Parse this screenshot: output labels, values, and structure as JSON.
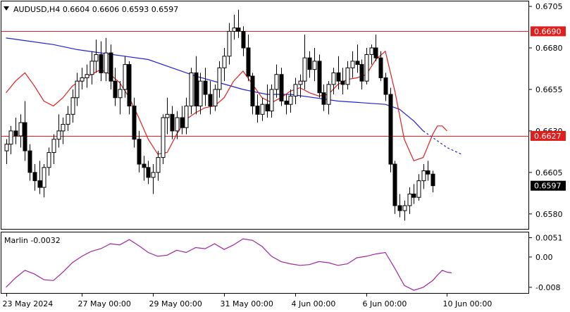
{
  "window": {
    "symbol_header": "AUDUSD,H4  0.6604 0.6606 0.6593 0.6597",
    "menu_icon": "triangle-down-icon"
  },
  "colors": {
    "background": "#ffffff",
    "frame": "#000000",
    "candle_border": "#000000",
    "bull_fill": "#ffffff",
    "bear_fill": "#000000",
    "ma_slow": "#1f23d6",
    "ma_fast": "#e01e1e",
    "hline": "#e01e1e",
    "level_label_bg": "#e01e1e",
    "current_label_bg": "#000000",
    "oscillator": "#a0269f"
  },
  "chart_data": [
    {
      "type": "candlestick",
      "title": "AUDUSD,H4  0.6604 0.6606 0.6593 0.6597",
      "timeframe": "H4",
      "ohlc_readout": {
        "open": 0.6604,
        "high": 0.6606,
        "low": 0.6593,
        "close": 0.6597
      },
      "ylim": [
        0.6571,
        0.6708
      ],
      "y_ticks": [
        "0.6705",
        "0.6680",
        "0.6655",
        "0.6630",
        "0.6605",
        "0.6580"
      ],
      "x_ticks": [
        "23 May 2024",
        "27 May 00:00",
        "29 May 00:00",
        "31 May 00:00",
        "4 Jun 00:00",
        "6 Jun 00:00",
        "10 Jun 00:00"
      ],
      "x_tick_index": [
        0,
        16,
        31,
        46,
        61,
        76,
        93
      ],
      "grid": false,
      "horizontal_levels": [
        {
          "value": 0.669,
          "label": "0.6690"
        },
        {
          "value": 0.6627,
          "label": "0.6627"
        }
      ],
      "current_price": {
        "value": 0.6597,
        "label": "0.6597"
      },
      "candles": [
        [
          0.6618,
          0.6625,
          0.661,
          0.6622
        ],
        [
          0.6622,
          0.6633,
          0.6616,
          0.663
        ],
        [
          0.663,
          0.6638,
          0.6622,
          0.6627
        ],
        [
          0.6627,
          0.664,
          0.662,
          0.6635
        ],
        [
          0.6635,
          0.6648,
          0.6612,
          0.6618
        ],
        [
          0.6618,
          0.6622,
          0.66,
          0.6605
        ],
        [
          0.6605,
          0.661,
          0.6594,
          0.66
        ],
        [
          0.66,
          0.6612,
          0.6592,
          0.6596
        ],
        [
          0.6596,
          0.661,
          0.659,
          0.6608
        ],
        [
          0.6608,
          0.662,
          0.6603,
          0.6617
        ],
        [
          0.6617,
          0.6628,
          0.661,
          0.6625
        ],
        [
          0.6625,
          0.664,
          0.662,
          0.663
        ],
        [
          0.663,
          0.6638,
          0.6622,
          0.6634
        ],
        [
          0.6634,
          0.6645,
          0.663,
          0.664
        ],
        [
          0.664,
          0.6655,
          0.6635,
          0.665
        ],
        [
          0.665,
          0.6665,
          0.6645,
          0.666
        ],
        [
          0.666,
          0.6668,
          0.6655,
          0.6662
        ],
        [
          0.6662,
          0.667,
          0.6656,
          0.6664
        ],
        [
          0.6664,
          0.6678,
          0.6658,
          0.6672
        ],
        [
          0.6672,
          0.6685,
          0.6665,
          0.6676
        ],
        [
          0.6676,
          0.6684,
          0.666,
          0.6665
        ],
        [
          0.6665,
          0.6686,
          0.666,
          0.6677
        ],
        [
          0.6677,
          0.6682,
          0.6655,
          0.666
        ],
        [
          0.666,
          0.6668,
          0.6645,
          0.665
        ],
        [
          0.665,
          0.666,
          0.664,
          0.6655
        ],
        [
          0.6655,
          0.6675,
          0.665,
          0.667
        ],
        [
          0.667,
          0.6672,
          0.664,
          0.6645
        ],
        [
          0.6645,
          0.665,
          0.662,
          0.6625
        ],
        [
          0.6625,
          0.663,
          0.6605,
          0.661
        ],
        [
          0.661,
          0.6615,
          0.66,
          0.6608
        ],
        [
          0.6608,
          0.6612,
          0.6598,
          0.6602
        ],
        [
          0.6602,
          0.661,
          0.6592,
          0.6605
        ],
        [
          0.6605,
          0.6618,
          0.66,
          0.6614
        ],
        [
          0.6614,
          0.664,
          0.661,
          0.6638
        ],
        [
          0.6638,
          0.665,
          0.6628,
          0.664
        ],
        [
          0.664,
          0.6645,
          0.6625,
          0.663
        ],
        [
          0.663,
          0.6642,
          0.6625,
          0.6638
        ],
        [
          0.6638,
          0.6645,
          0.6628,
          0.6632
        ],
        [
          0.6632,
          0.665,
          0.6628,
          0.6645
        ],
        [
          0.6645,
          0.6668,
          0.664,
          0.6665
        ],
        [
          0.6665,
          0.6675,
          0.664,
          0.6645
        ],
        [
          0.6645,
          0.6665,
          0.664,
          0.666
        ],
        [
          0.666,
          0.6668,
          0.6645,
          0.6652
        ],
        [
          0.6652,
          0.666,
          0.664,
          0.6645
        ],
        [
          0.6645,
          0.6658,
          0.6642,
          0.6655
        ],
        [
          0.6655,
          0.6672,
          0.665,
          0.6668
        ],
        [
          0.6668,
          0.668,
          0.666,
          0.6675
        ],
        [
          0.6675,
          0.6695,
          0.667,
          0.669
        ],
        [
          0.669,
          0.67,
          0.6685,
          0.6692
        ],
        [
          0.6692,
          0.6703,
          0.6686,
          0.669
        ],
        [
          0.669,
          0.6693,
          0.6675,
          0.668
        ],
        [
          0.668,
          0.6688,
          0.666,
          0.6663
        ],
        [
          0.6663,
          0.6665,
          0.664,
          0.6645
        ],
        [
          0.6645,
          0.6652,
          0.6635,
          0.664
        ],
        [
          0.664,
          0.665,
          0.6636,
          0.6646
        ],
        [
          0.6646,
          0.6658,
          0.6638,
          0.6642
        ],
        [
          0.6642,
          0.6658,
          0.6638,
          0.6655
        ],
        [
          0.6655,
          0.667,
          0.665,
          0.6664
        ],
        [
          0.6664,
          0.6668,
          0.6645,
          0.6648
        ],
        [
          0.6648,
          0.6652,
          0.664,
          0.6646
        ],
        [
          0.6646,
          0.6655,
          0.6641,
          0.6651
        ],
        [
          0.6651,
          0.6662,
          0.6646,
          0.6658
        ],
        [
          0.6658,
          0.6664,
          0.665,
          0.666
        ],
        [
          0.666,
          0.6688,
          0.6655,
          0.6674
        ],
        [
          0.6674,
          0.6678,
          0.6662,
          0.6667
        ],
        [
          0.6667,
          0.668,
          0.666,
          0.6672
        ],
        [
          0.6672,
          0.6676,
          0.665,
          0.6653
        ],
        [
          0.6653,
          0.6658,
          0.6642,
          0.6646
        ],
        [
          0.6646,
          0.666,
          0.664,
          0.6658
        ],
        [
          0.6658,
          0.6668,
          0.6652,
          0.6665
        ],
        [
          0.6665,
          0.6675,
          0.6655,
          0.666
        ],
        [
          0.666,
          0.6668,
          0.6652,
          0.6658
        ],
        [
          0.6658,
          0.6672,
          0.6655,
          0.6668
        ],
        [
          0.6668,
          0.6678,
          0.6662,
          0.6672
        ],
        [
          0.6672,
          0.6682,
          0.6665,
          0.667
        ],
        [
          0.667,
          0.6673,
          0.6655,
          0.666
        ],
        [
          0.666,
          0.668,
          0.6658,
          0.6676
        ],
        [
          0.6676,
          0.6682,
          0.667,
          0.668
        ],
        [
          0.668,
          0.6688,
          0.6672,
          0.6674
        ],
        [
          0.6674,
          0.6678,
          0.666,
          0.6662
        ],
        [
          0.6662,
          0.6665,
          0.6648,
          0.6652
        ],
        [
          0.6652,
          0.6656,
          0.6605,
          0.661
        ],
        [
          0.661,
          0.6612,
          0.658,
          0.6585
        ],
        [
          0.6585,
          0.6592,
          0.6578,
          0.6582
        ],
        [
          0.6582,
          0.6588,
          0.6576,
          0.6585
        ],
        [
          0.6585,
          0.6596,
          0.658,
          0.6592
        ],
        [
          0.6592,
          0.6598,
          0.6586,
          0.659
        ],
        [
          0.659,
          0.6604,
          0.6588,
          0.66
        ],
        [
          0.66,
          0.661,
          0.6595,
          0.6606
        ],
        [
          0.6606,
          0.6612,
          0.66,
          0.6604
        ],
        [
          0.6604,
          0.6606,
          0.6593,
          0.6597
        ]
      ],
      "ma_slow": [
        [
          0,
          0.6686
        ],
        [
          5,
          0.6684
        ],
        [
          10,
          0.6682
        ],
        [
          15,
          0.6679
        ],
        [
          20,
          0.6677
        ],
        [
          25,
          0.6675
        ],
        [
          30,
          0.6673
        ],
        [
          35,
          0.6668
        ],
        [
          40,
          0.6663
        ],
        [
          45,
          0.6659
        ],
        [
          50,
          0.6655
        ],
        [
          55,
          0.6652
        ],
        [
          60,
          0.6652
        ],
        [
          65,
          0.665
        ],
        [
          70,
          0.6648
        ],
        [
          75,
          0.6647
        ],
        [
          80,
          0.6646
        ],
        [
          83,
          0.6643
        ],
        [
          86,
          0.6636
        ],
        [
          88,
          0.663
        ],
        [
          90,
          0.6626
        ],
        [
          93,
          0.662
        ],
        [
          96,
          0.6616
        ]
      ],
      "ma_slow_dashed_from": 88,
      "ma_fast": [
        [
          0,
          0.6653
        ],
        [
          2,
          0.666
        ],
        [
          4,
          0.6665
        ],
        [
          6,
          0.6657
        ],
        [
          8,
          0.6648
        ],
        [
          10,
          0.6645
        ],
        [
          12,
          0.665
        ],
        [
          14,
          0.6657
        ],
        [
          16,
          0.6661
        ],
        [
          18,
          0.6664
        ],
        [
          20,
          0.6667
        ],
        [
          22,
          0.6664
        ],
        [
          24,
          0.6659
        ],
        [
          26,
          0.665
        ],
        [
          28,
          0.6638
        ],
        [
          30,
          0.6625
        ],
        [
          32,
          0.6616
        ],
        [
          34,
          0.6617
        ],
        [
          36,
          0.6628
        ],
        [
          38,
          0.6637
        ],
        [
          40,
          0.6641
        ],
        [
          42,
          0.6644
        ],
        [
          44,
          0.6645
        ],
        [
          46,
          0.665
        ],
        [
          48,
          0.666
        ],
        [
          50,
          0.6666
        ],
        [
          52,
          0.6658
        ],
        [
          54,
          0.665
        ],
        [
          56,
          0.6647
        ],
        [
          58,
          0.665
        ],
        [
          60,
          0.6654
        ],
        [
          62,
          0.6656
        ],
        [
          64,
          0.6653
        ],
        [
          66,
          0.6651
        ],
        [
          68,
          0.6652
        ],
        [
          70,
          0.6658
        ],
        [
          72,
          0.6661
        ],
        [
          74,
          0.6662
        ],
        [
          76,
          0.6664
        ],
        [
          78,
          0.6673
        ],
        [
          80,
          0.6678
        ],
        [
          82,
          0.6654
        ],
        [
          84,
          0.6625
        ],
        [
          86,
          0.6612
        ],
        [
          88,
          0.6614
        ],
        [
          90,
          0.6628
        ],
        [
          91,
          0.6633
        ],
        [
          92,
          0.6633
        ],
        [
          93,
          0.663
        ]
      ]
    },
    {
      "type": "line",
      "indicator_label": "Marlin -0.0032",
      "name": "Marlin",
      "current_value": -0.0032,
      "ylim": [
        -0.0095,
        0.0065
      ],
      "y_ticks": [
        "0.0051",
        "0.00",
        "-0.008"
      ],
      "values": [
        [
          0,
          -0.008
        ],
        [
          2,
          -0.0055
        ],
        [
          4,
          -0.0035
        ],
        [
          6,
          -0.0045
        ],
        [
          8,
          -0.006
        ],
        [
          10,
          -0.0062
        ],
        [
          12,
          -0.004
        ],
        [
          14,
          -0.0015
        ],
        [
          16,
          0.0002
        ],
        [
          18,
          0.0015
        ],
        [
          20,
          0.0022
        ],
        [
          22,
          0.0035
        ],
        [
          24,
          0.0032
        ],
        [
          26,
          0.0046
        ],
        [
          28,
          0.003
        ],
        [
          30,
          0.0012
        ],
        [
          32,
          0.0002
        ],
        [
          34,
          0.0005
        ],
        [
          36,
          0.0018
        ],
        [
          38,
          0.0012
        ],
        [
          40,
          0.0025
        ],
        [
          42,
          0.0022
        ],
        [
          44,
          0.0035
        ],
        [
          46,
          0.002
        ],
        [
          48,
          0.0032
        ],
        [
          50,
          0.0048
        ],
        [
          52,
          0.0044
        ],
        [
          54,
          0.0028
        ],
        [
          56,
          0.0002
        ],
        [
          58,
          -0.0012
        ],
        [
          60,
          -0.0018
        ],
        [
          62,
          -0.0022
        ],
        [
          64,
          -0.002
        ],
        [
          66,
          -0.0012
        ],
        [
          68,
          -0.0015
        ],
        [
          70,
          -0.0022
        ],
        [
          72,
          -0.0018
        ],
        [
          74,
          -0.0002
        ],
        [
          76,
          0.0002
        ],
        [
          78,
          0.0008
        ],
        [
          80,
          0.0012
        ],
        [
          82,
          -0.003
        ],
        [
          84,
          -0.0075
        ],
        [
          86,
          -0.0088
        ],
        [
          88,
          -0.008
        ],
        [
          90,
          -0.0062
        ],
        [
          91,
          -0.0048
        ],
        [
          92,
          -0.0035
        ],
        [
          93,
          -0.004
        ],
        [
          94,
          -0.0042
        ]
      ]
    }
  ]
}
